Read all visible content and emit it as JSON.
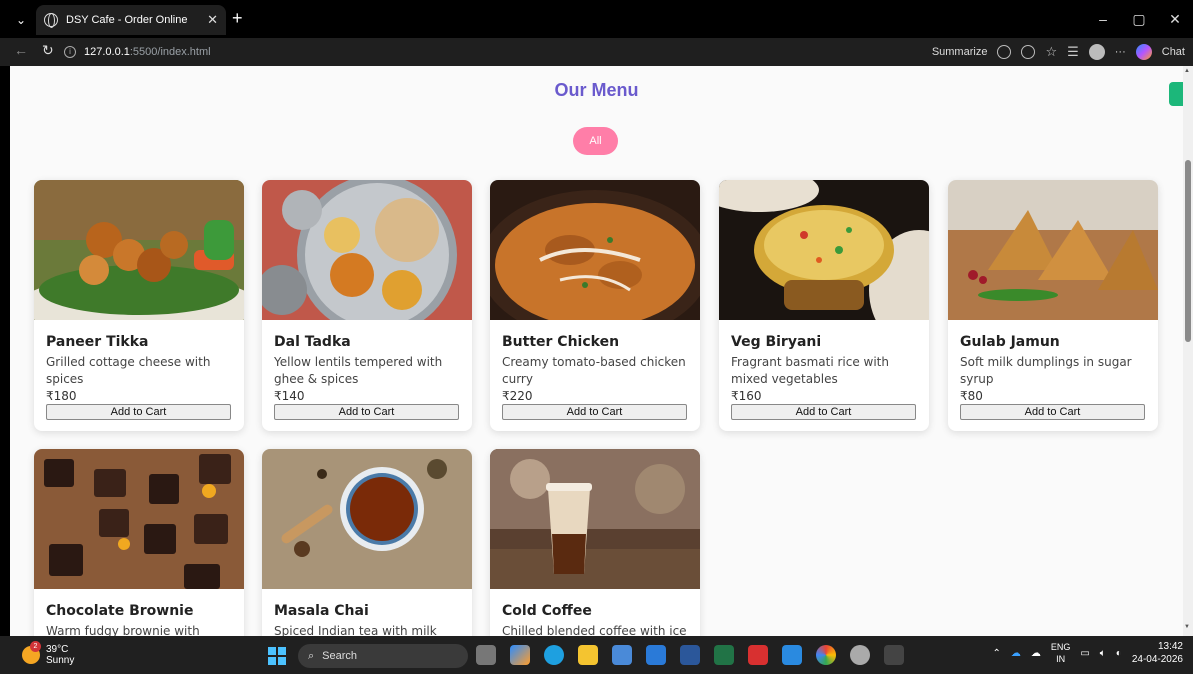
{
  "browser": {
    "tab_title": "DSY Cafe - Order Online",
    "url_host": "127.0.0.1",
    "url_path": ":5500/index.html",
    "summarize_label": "Summarize",
    "chat_label": "Chat"
  },
  "page": {
    "title": "Our Menu",
    "filter_all": "All"
  },
  "menu_items": [
    {
      "name": "Paneer Tikka",
      "desc": "Grilled cottage cheese with spices",
      "price": "₹180",
      "button": "Add to Cart"
    },
    {
      "name": "Dal Tadka",
      "desc": "Yellow lentils tempered with ghee & spices",
      "price": "₹140",
      "button": "Add to Cart"
    },
    {
      "name": "Butter Chicken",
      "desc": "Creamy tomato-based chicken curry",
      "price": "₹220",
      "button": "Add to Cart"
    },
    {
      "name": "Veg Biryani",
      "desc": "Fragrant basmati rice with mixed vegetables",
      "price": "₹160",
      "button": "Add to Cart"
    },
    {
      "name": "Gulab Jamun",
      "desc": "Soft milk dumplings in sugar syrup",
      "price": "₹80",
      "button": "Add to Cart"
    },
    {
      "name": "Chocolate Brownie",
      "desc": "Warm fudgy brownie with vanilla"
    },
    {
      "name": "Masala Chai",
      "desc": "Spiced Indian tea with milk"
    },
    {
      "name": "Cold Coffee",
      "desc": "Chilled blended coffee with ice"
    }
  ],
  "taskbar": {
    "temp": "39°C",
    "weather": "Sunny",
    "weather_badge": "2",
    "search": "Search",
    "lang_top": "ENG",
    "lang_bottom": "IN",
    "time": "13:42",
    "date": "24-04-2026"
  },
  "colors": {
    "title": "#6a5acd",
    "filter_pill": "#ff7ea8"
  }
}
